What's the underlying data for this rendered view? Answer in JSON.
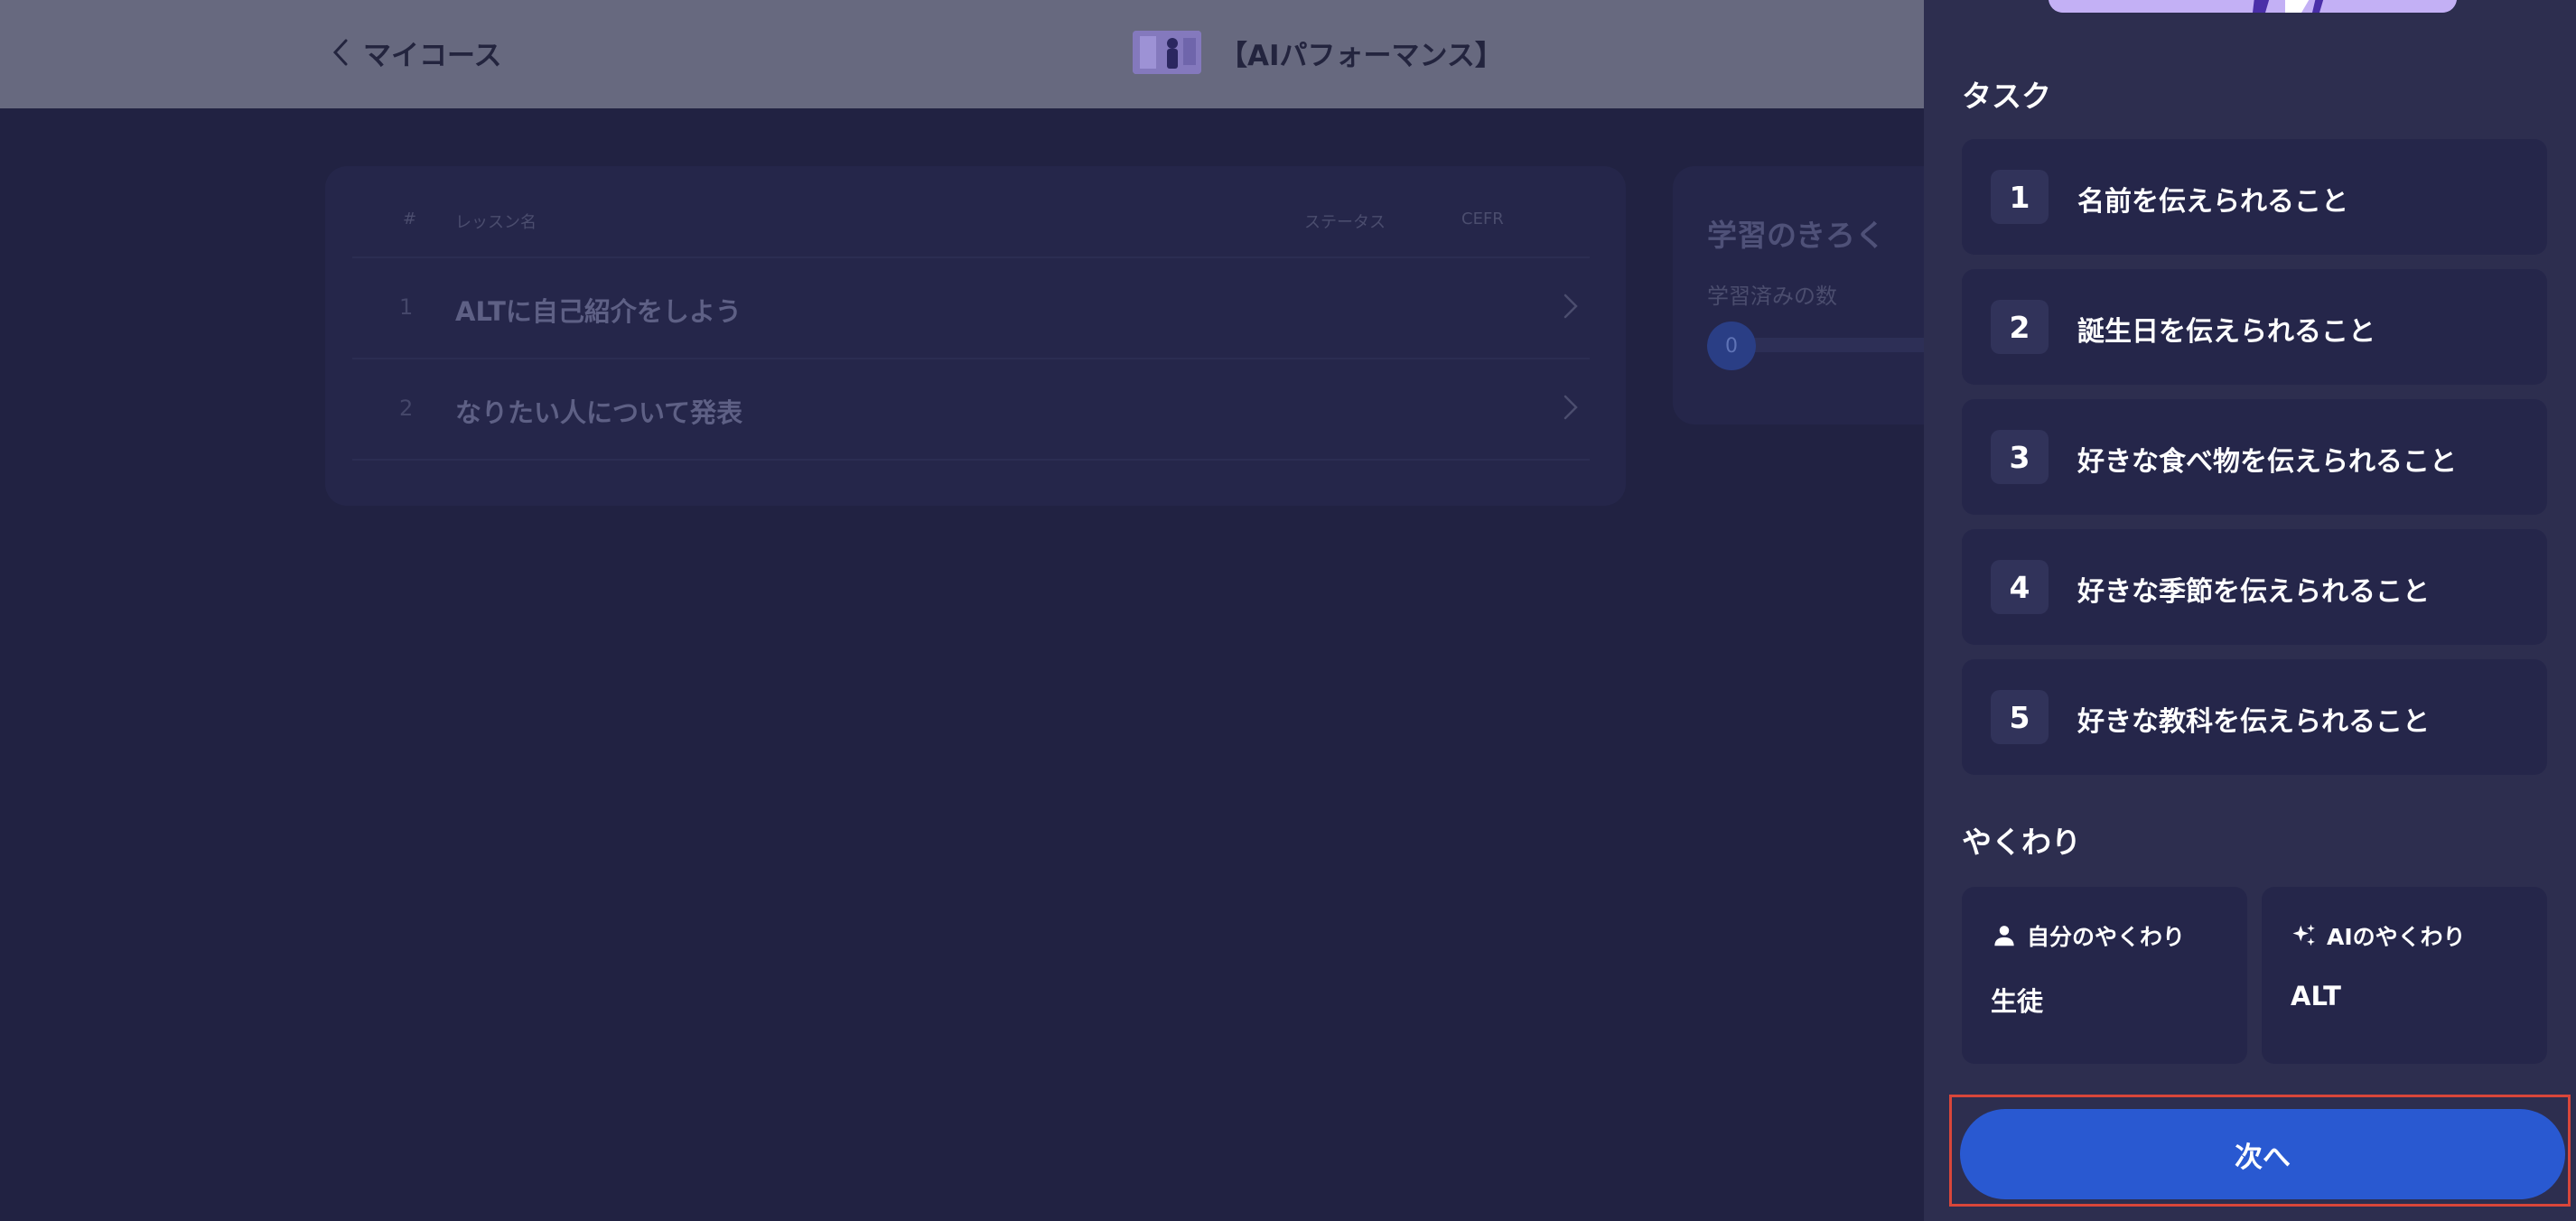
{
  "header": {
    "back_label": "マイコース",
    "course_title": "【AIパフォーマンス】"
  },
  "lessons": {
    "columns": {
      "number": "#",
      "name": "レッスン名",
      "status": "ステータス",
      "cefr": "CEFR"
    },
    "rows": [
      {
        "number": "1",
        "name": "ALTに自己紹介をしよう"
      },
      {
        "number": "2",
        "name": "なりたい人について発表"
      }
    ]
  },
  "record": {
    "title": "学習のきろく",
    "subtitle": "学習済みの数",
    "count": "0"
  },
  "panel": {
    "task_title": "タスク",
    "tasks": [
      {
        "number": "1",
        "label": "名前を伝えられること"
      },
      {
        "number": "2",
        "label": "誕生日を伝えられること"
      },
      {
        "number": "3",
        "label": "好きな食べ物を伝えられること"
      },
      {
        "number": "4",
        "label": "好きな季節を伝えられること"
      },
      {
        "number": "5",
        "label": "好きな教科を伝えられること"
      }
    ],
    "role_title": "やくわり",
    "roles": {
      "self": {
        "icon": "person-icon",
        "heading": "自分のやくわり",
        "value": "生徒"
      },
      "ai": {
        "icon": "sparkle-icon",
        "heading": "AIのやくわり",
        "value": "ALT"
      }
    },
    "next_label": "次へ"
  },
  "colors": {
    "overlay_background": "#212242",
    "panel_background": "#2d2e4f",
    "card_background": "#25264a",
    "primary_button": "#2959d1",
    "highlight_border": "#d9463a"
  }
}
